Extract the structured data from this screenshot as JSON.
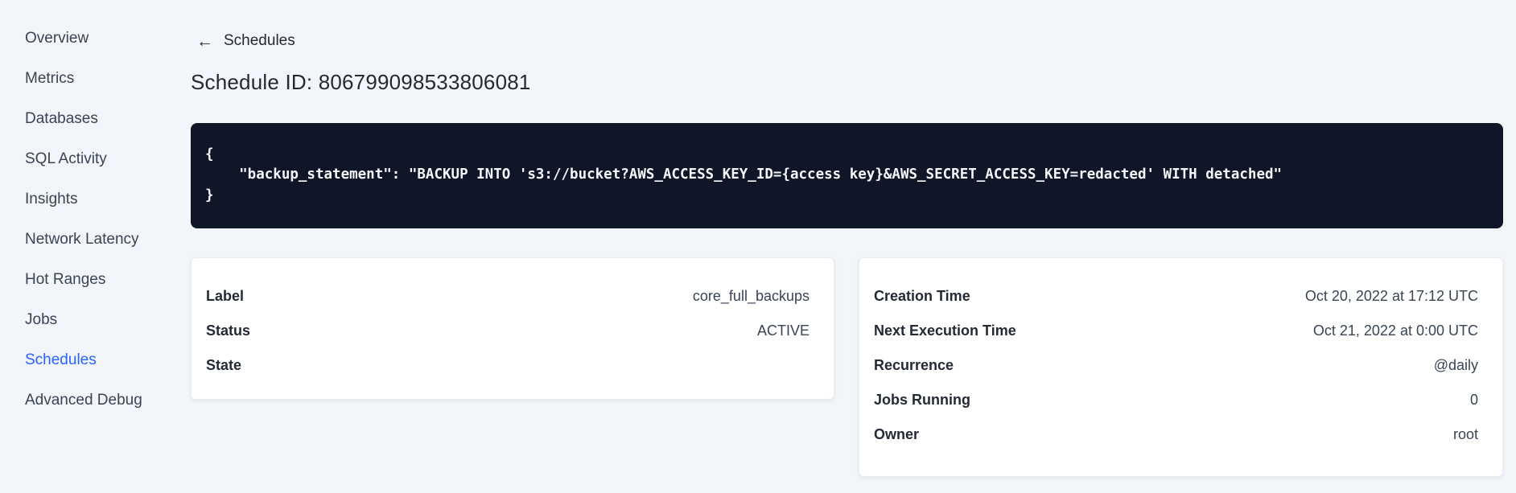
{
  "theme": {
    "page_bg": "#f2f5f9",
    "accent": "#2962ff",
    "text_dark": "#242a35",
    "text_body": "#394455",
    "code_bg": "#0f1628",
    "code_text": "#f5f7fa",
    "card_border": "#e7ecf2"
  },
  "sidebar": {
    "items": [
      {
        "label": "Overview",
        "name": "sidebar-item-overview",
        "active": false
      },
      {
        "label": "Metrics",
        "name": "sidebar-item-metrics",
        "active": false
      },
      {
        "label": "Databases",
        "name": "sidebar-item-databases",
        "active": false
      },
      {
        "label": "SQL Activity",
        "name": "sidebar-item-sql-activity",
        "active": false
      },
      {
        "label": "Insights",
        "name": "sidebar-item-insights",
        "active": false
      },
      {
        "label": "Network Latency",
        "name": "sidebar-item-network-latency",
        "active": false
      },
      {
        "label": "Hot Ranges",
        "name": "sidebar-item-hot-ranges",
        "active": false
      },
      {
        "label": "Jobs",
        "name": "sidebar-item-jobs",
        "active": false
      },
      {
        "label": "Schedules",
        "name": "sidebar-item-schedules",
        "active": true
      },
      {
        "label": "Advanced Debug",
        "name": "sidebar-item-advanced-debug",
        "active": false
      }
    ]
  },
  "header": {
    "back_icon": "←",
    "back_label": "Schedules",
    "title": "Schedule ID: 806799098533806081"
  },
  "code_block": {
    "lines": [
      "{",
      "    \"backup_statement\": \"BACKUP INTO 's3://bucket?AWS_ACCESS_KEY_ID={access key}&AWS_SECRET_ACCESS_KEY=redacted' WITH detached\"",
      "}"
    ]
  },
  "summary_card": {
    "rows": [
      {
        "label": "Label",
        "value": "core_full_backups"
      },
      {
        "label": "Status",
        "value": "ACTIVE"
      },
      {
        "label": "State",
        "value": ""
      }
    ]
  },
  "details_card": {
    "rows": [
      {
        "label": "Creation Time",
        "value": "Oct 20, 2022 at 17:12 UTC"
      },
      {
        "label": "Next Execution Time",
        "value": "Oct 21, 2022 at 0:00 UTC"
      },
      {
        "label": "Recurrence",
        "value": "@daily"
      },
      {
        "label": "Jobs Running",
        "value": "0"
      },
      {
        "label": "Owner",
        "value": "root"
      }
    ]
  }
}
